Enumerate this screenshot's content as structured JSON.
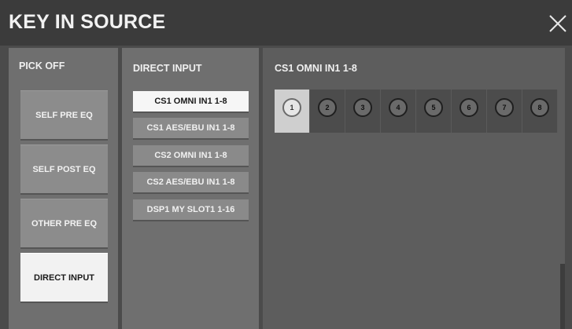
{
  "window": {
    "title": "KEY IN SOURCE",
    "close_icon": "close-icon"
  },
  "pick_off": {
    "title": "PICK OFF",
    "buttons": [
      {
        "label": "SELF PRE EQ",
        "active": false
      },
      {
        "label": "SELF POST EQ",
        "active": false
      },
      {
        "label": "OTHER PRE EQ",
        "active": false
      },
      {
        "label": "DIRECT INPUT",
        "active": true
      }
    ]
  },
  "direct_input": {
    "title": "DIRECT INPUT",
    "sources": [
      {
        "label": "CS1 OMNI IN1 1-8",
        "active": true
      },
      {
        "label": "CS1 AES/EBU IN1 1-8",
        "active": false
      },
      {
        "label": "CS2 OMNI IN1 1-8",
        "active": false
      },
      {
        "label": "CS2 AES/EBU IN1 1-8",
        "active": false
      },
      {
        "label": "DSP1 MY SLOT1 1-16",
        "active": false
      }
    ]
  },
  "channels": {
    "title": "CS1 OMNI IN1 1-8",
    "items": [
      {
        "label": "1",
        "active": true
      },
      {
        "label": "2",
        "active": false
      },
      {
        "label": "3",
        "active": false
      },
      {
        "label": "4",
        "active": false
      },
      {
        "label": "5",
        "active": false
      },
      {
        "label": "6",
        "active": false
      },
      {
        "label": "7",
        "active": false
      },
      {
        "label": "8",
        "active": false
      }
    ]
  },
  "colors": {
    "title_bar": "#3b3b3b",
    "panel": "#6f6f6f",
    "button": "#8c8c8c",
    "button_active": "#f2f2f2"
  }
}
